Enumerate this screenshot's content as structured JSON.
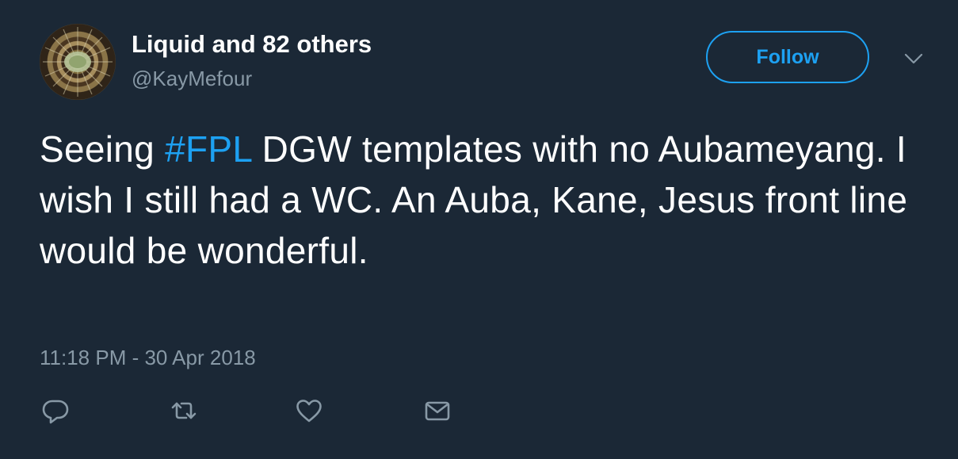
{
  "tweet": {
    "author_name": "Liquid and 82 others",
    "handle": "@KayMefour",
    "follow_label": "Follow",
    "text_before": "Seeing ",
    "hashtag": "#FPL",
    "text_after": " DGW templates with no Aubameyang. I wish I still had a WC. An Auba, Kane, Jesus front line would be wonderful.",
    "timestamp": "11:18 PM - 30 Apr 2018"
  },
  "icons": {
    "avatar": "avatar-image",
    "menu": "chevron-down-icon",
    "reply": "reply-icon",
    "retweet": "retweet-icon",
    "like": "heart-icon",
    "message": "envelope-icon"
  },
  "colors": {
    "background": "#1b2836",
    "accent": "#1da1f2",
    "secondary_text": "#8899a6",
    "primary_text": "#ffffff"
  }
}
